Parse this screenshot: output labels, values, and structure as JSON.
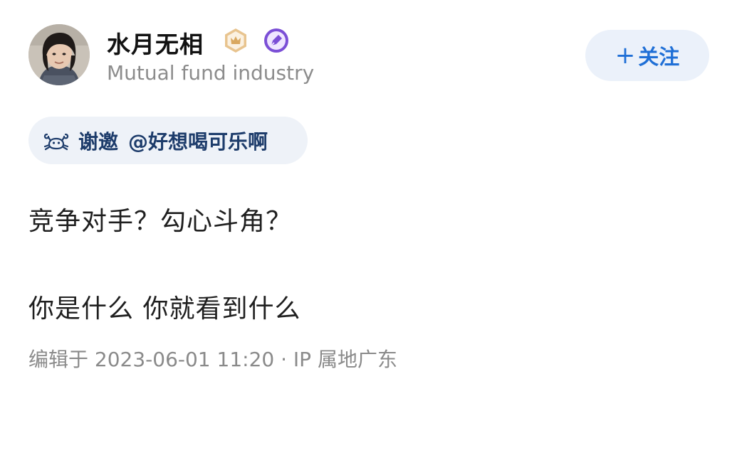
{
  "author": {
    "name": "水月无相",
    "headline": "Mutual fund industry",
    "badges": [
      "crown-badge-icon",
      "pen-badge-icon"
    ]
  },
  "follow_button": {
    "plus": "+",
    "label": "关注"
  },
  "invite": {
    "icon": "crab-icon",
    "label": "谢邀",
    "mention": "@好想喝可乐啊"
  },
  "answer": {
    "line1": "竞争对手？勾心斗角？",
    "line2": "你是什么 你就看到什么"
  },
  "meta": {
    "edit_info": "编辑于 2023-06-01 11:20 · IP 属地广东"
  },
  "colors": {
    "accent": "#1f6fd6",
    "follow_bg": "#ebf1fa",
    "chip_bg": "#eef2f8",
    "chip_text": "#1d3c6b",
    "muted_text": "#8a8a8a",
    "crown_badge": "#d9a860",
    "pen_badge": "#7b4fd6"
  }
}
